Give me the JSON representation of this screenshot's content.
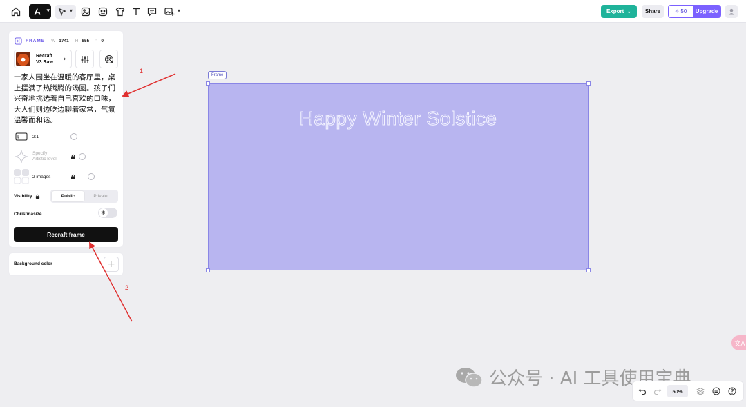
{
  "toolbar": {
    "export_label": "Export",
    "share_label": "Share",
    "credits": "50",
    "upgrade_label": "Upgrade",
    "icons": [
      "home-icon",
      "logo-icon",
      "select-tool-icon",
      "image-icon",
      "sticker-icon",
      "shirt-mockup-icon",
      "text-tool-icon",
      "comment-icon",
      "image-plus-icon"
    ]
  },
  "panel": {
    "frame_label": "FRAME",
    "width_key": "W",
    "width_value": "1741",
    "height_key": "H",
    "height_value": "855",
    "radius_value": "0",
    "model_name_line1": "Recraft",
    "model_name_line2": "V3 Raw",
    "prompt": "一家人围坐在温暖的客厅里，桌上摆满了热腾腾的汤圆。孩子们兴奋地挑选着自己喜欢的口味，大人们则边吃边聊着家常，气氛温馨而和谐。",
    "aspect_ratio": "2:1",
    "artistic_line1": "Specify",
    "artistic_line2": "Artistic level",
    "images_count": "2 images",
    "visibility_label": "Visibility",
    "visibility_options": [
      "Public",
      "Private"
    ],
    "visibility_selected": "Public",
    "christmasize_label": "Christmasize",
    "recraft_button": "Recraft frame"
  },
  "background": {
    "label": "Background color"
  },
  "canvas": {
    "frame_tag": "Frame",
    "frame_text": "Happy Winter Solstice",
    "frame_color": "#b8b5f0"
  },
  "annotations": {
    "num1": "1",
    "num2": "2",
    "color": "#e03030"
  },
  "watermark": {
    "text": "公众号 · AI 工具使用宝典"
  },
  "side": {
    "translate_label": "文A"
  },
  "zoombar": {
    "zoom": "50%"
  },
  "colors": {
    "accent": "#7b61ff",
    "export": "#1fb39a"
  }
}
